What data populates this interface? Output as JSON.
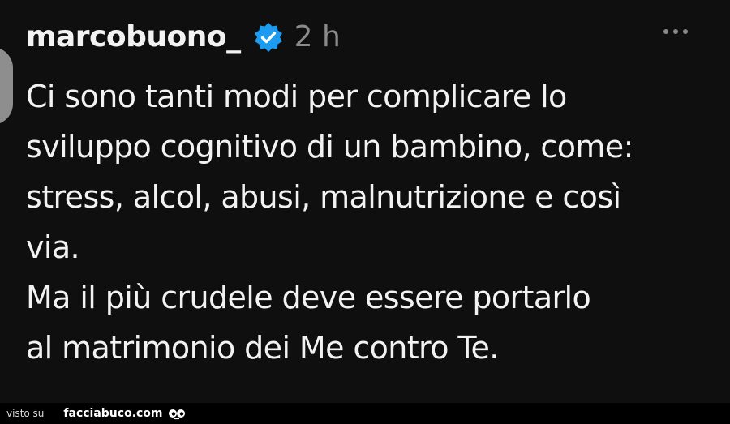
{
  "post": {
    "username": "marcobuono_",
    "time": "2 h",
    "text_lines": [
      "Ci sono tanti modi per complicare lo",
      "sviluppo cognitivo di un bambino, come:",
      "stress, alcol, abusi, malnutrizione e così",
      "via.",
      "Ma il più crudele deve essere portarlo",
      "al matrimonio dei Me contro Te."
    ]
  },
  "footer": {
    "visto_label": "visto su",
    "site_label": "facciabuco.com"
  },
  "colors": {
    "background": "#0f0f10",
    "text": "#f2f2f2",
    "muted": "#8a8a8a",
    "verified_badge": "#1d9bf0"
  },
  "icons": {
    "verified": "verified-badge-icon",
    "more": "more-options-icon",
    "footer_logo": "eyes-icon"
  }
}
